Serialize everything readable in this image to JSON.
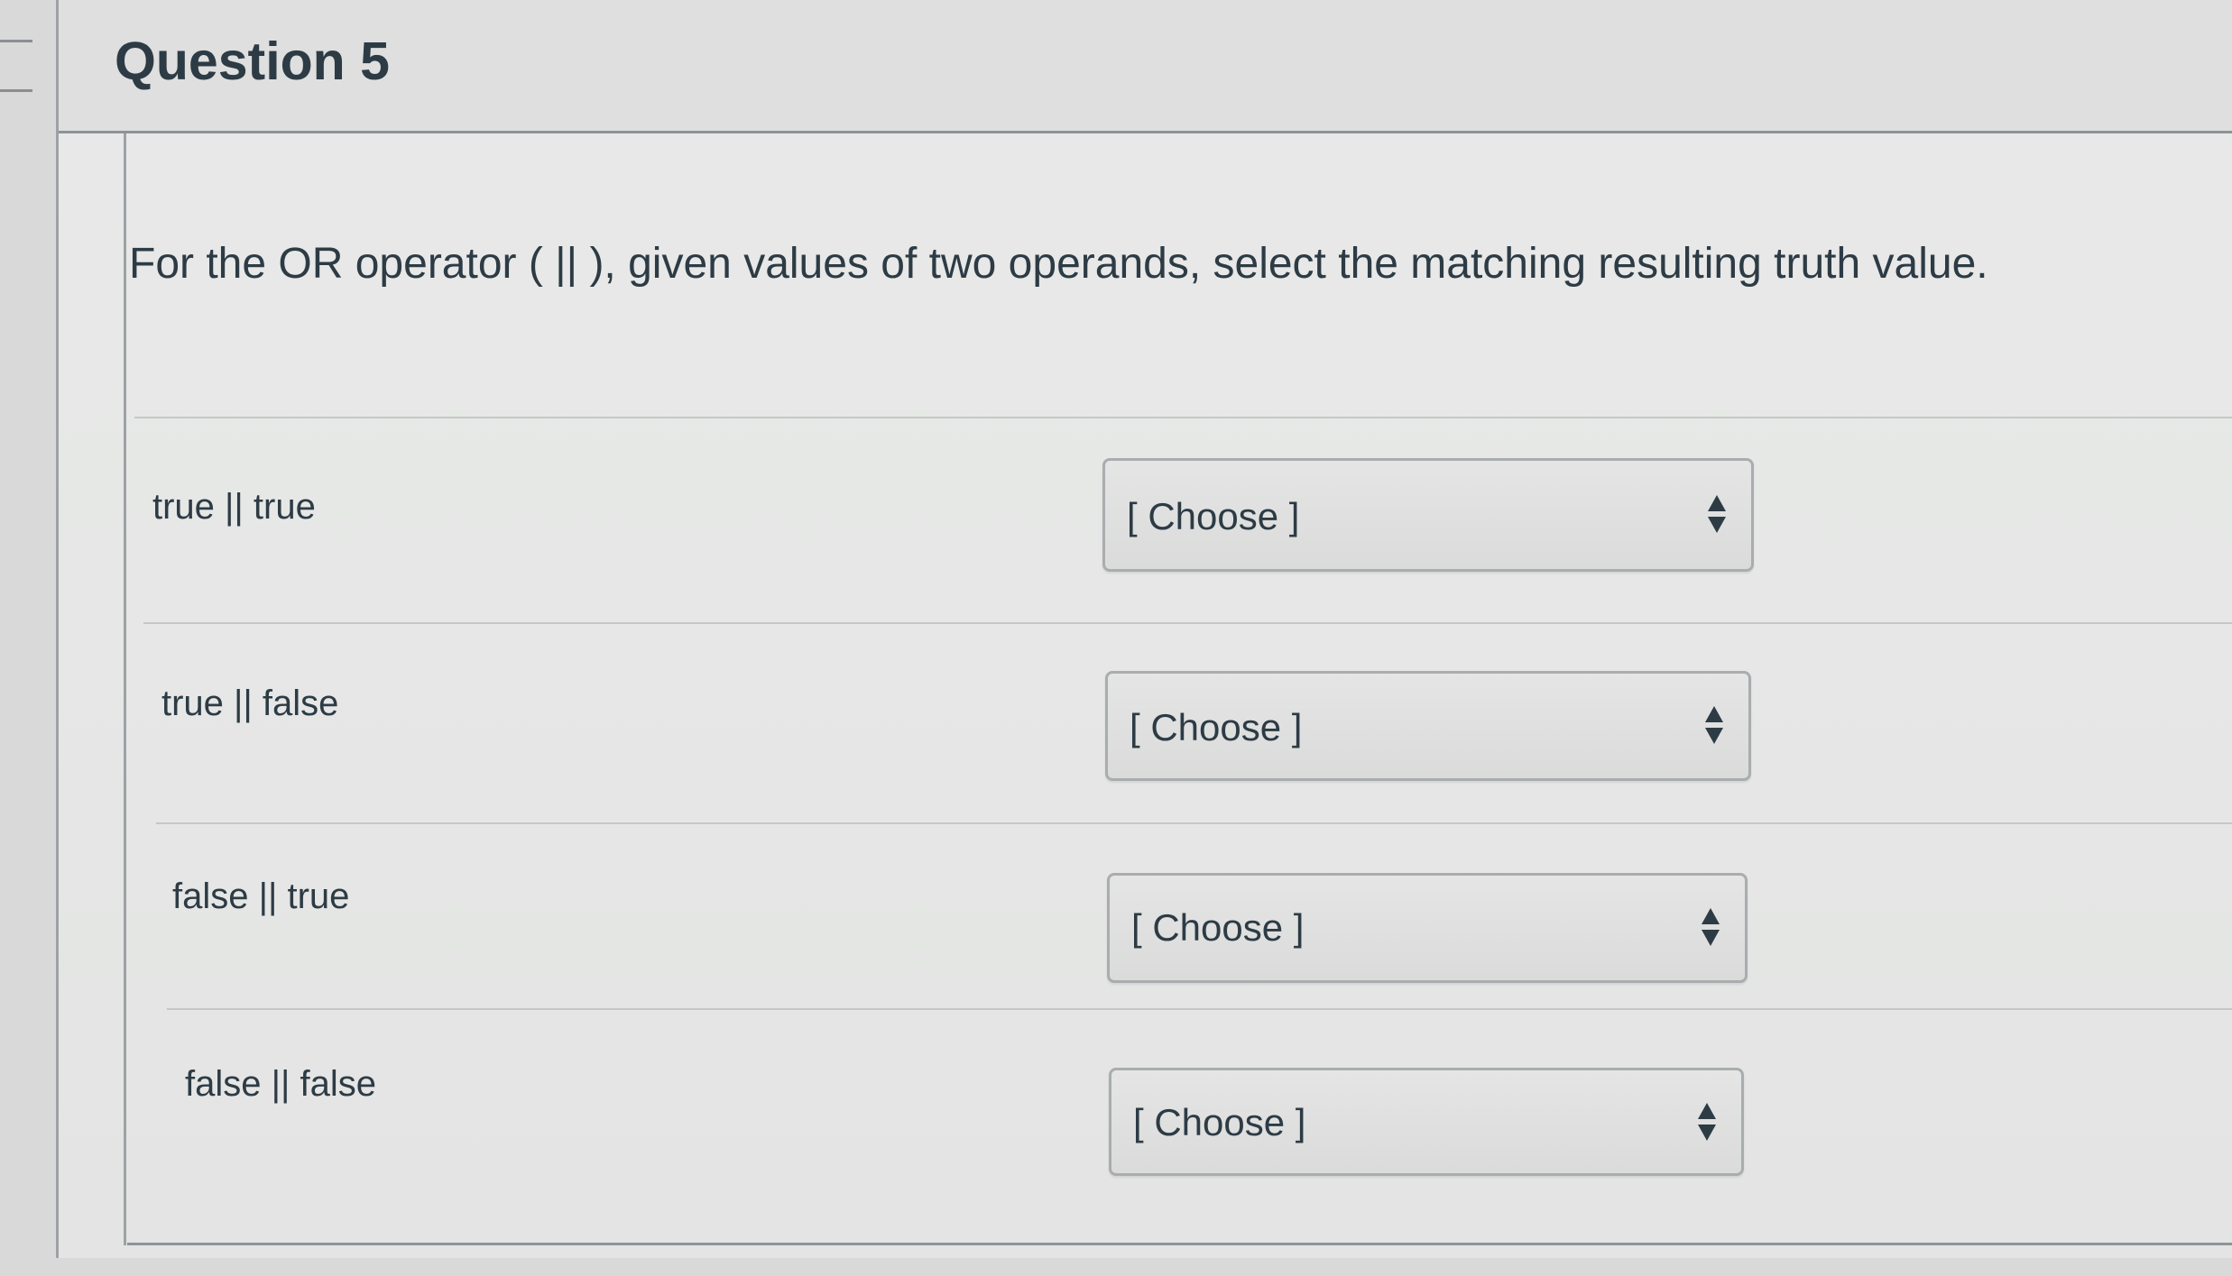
{
  "question": {
    "title": "Question 5",
    "prompt": "For the OR operator ( || ), given values of two operands, select the matching resulting truth value."
  },
  "rows": [
    {
      "label": "true || true",
      "select_value": "[ Choose ]"
    },
    {
      "label": "true || false",
      "select_value": "[ Choose ]"
    },
    {
      "label": "false || true",
      "select_value": "[ Choose ]"
    },
    {
      "label": "false || false",
      "select_value": "[ Choose ]"
    }
  ],
  "colors": {
    "text": "#2d3b45",
    "page_bg": "#d8d9d8",
    "card_bg": "#e6e7e6",
    "border": "#9ea2a5"
  }
}
